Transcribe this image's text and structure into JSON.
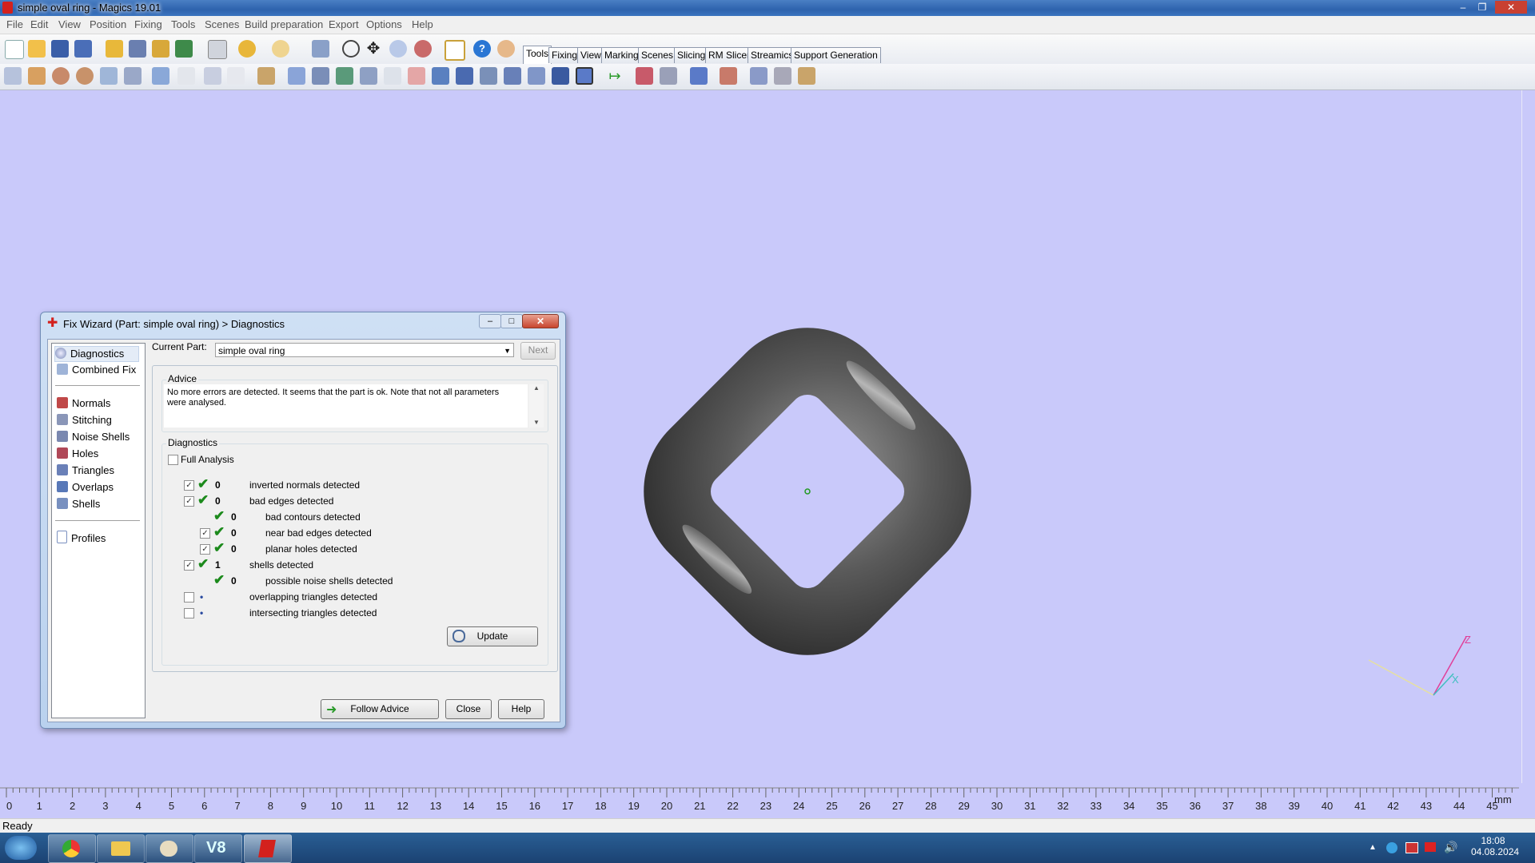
{
  "window": {
    "title": "simple oval ring - Magics 19.01"
  },
  "menu": [
    "File",
    "Edit",
    "View",
    "Position",
    "Fixing",
    "Tools",
    "Scenes",
    "Build preparation",
    "Export",
    "Options",
    "Help"
  ],
  "ribbon_tabs": [
    "Tools",
    "Fixing",
    "View",
    "Marking",
    "Scenes",
    "Slicing",
    "RM Slicer",
    "Streamics",
    "Support Generation"
  ],
  "dialog": {
    "title": "Fix Wizard (Part: simple oval ring) > Diagnostics",
    "nav_top": [
      "Diagnostics",
      "Combined Fix"
    ],
    "nav_mid": [
      "Normals",
      "Stitching",
      "Noise Shells",
      "Holes",
      "Triangles",
      "Overlaps",
      "Shells"
    ],
    "nav_bottom": [
      "Profiles"
    ],
    "current_part_label": "Current Part:",
    "current_part_value": "simple oval ring",
    "next_label": "Next",
    "advice_label": "Advice",
    "advice_text": "No more errors are detected. It seems that the part is ok. Note that not all parameters were analysed.",
    "diagnostics_label": "Diagnostics",
    "full_analysis_label": "Full Analysis",
    "rows": [
      {
        "count": "0",
        "label": "inverted normals detected",
        "checked": true,
        "indent": 0
      },
      {
        "count": "0",
        "label": "bad edges detected",
        "checked": true,
        "indent": 0
      },
      {
        "count": "0",
        "label": "bad contours detected",
        "checked": null,
        "indent": 1
      },
      {
        "count": "0",
        "label": "near bad edges detected",
        "checked": true,
        "indent": 1
      },
      {
        "count": "0",
        "label": "planar holes detected",
        "checked": true,
        "indent": 1
      },
      {
        "count": "1",
        "label": "shells detected",
        "checked": true,
        "indent": 0
      },
      {
        "count": "0",
        "label": "possible noise shells detected",
        "checked": null,
        "indent": 1
      },
      {
        "count": "•",
        "label": "overlapping triangles detected",
        "checked": false,
        "indent": 0
      },
      {
        "count": "•",
        "label": "intersecting triangles detected",
        "checked": false,
        "indent": 0
      }
    ],
    "update_label": "Update",
    "follow_advice_label": "Follow Advice",
    "close_label": "Close",
    "help_label": "Help"
  },
  "ruler": {
    "ticks": [
      "0",
      "1",
      "2",
      "3",
      "4",
      "5",
      "6",
      "7",
      "8",
      "9",
      "10",
      "11",
      "12",
      "13",
      "14",
      "15",
      "16",
      "17",
      "18",
      "19",
      "20",
      "21",
      "22",
      "23",
      "24",
      "25",
      "26",
      "27",
      "28",
      "29",
      "30",
      "31",
      "32",
      "33",
      "34",
      "35",
      "36",
      "37",
      "38",
      "39",
      "40",
      "41",
      "42",
      "43",
      "44",
      "45"
    ],
    "unit": "mm"
  },
  "axes": {
    "z": "Z",
    "x": "X"
  },
  "status": {
    "text": "Ready"
  },
  "taskbar": {
    "time": "18:08",
    "date": "04.08.2024"
  },
  "colors": {
    "viewport_bg": "#c9c9fa",
    "ring": "#5e5e5e",
    "check_green": "#1c8a1c",
    "brand_red": "#d3211d"
  },
  "toolbar_icons": [
    "new-icon",
    "open-icon",
    "save-icon",
    "save-as-icon",
    "import-icon",
    "export-icon",
    "load-icon",
    "unload-icon",
    "print-icon",
    "undo-icon",
    "redo-icon",
    "select-icon",
    "rotate-icon",
    "pan-icon",
    "zoom-icon",
    "zoom-fit-icon",
    "fix-wizard-icon",
    "help-icon",
    "info-icon"
  ]
}
